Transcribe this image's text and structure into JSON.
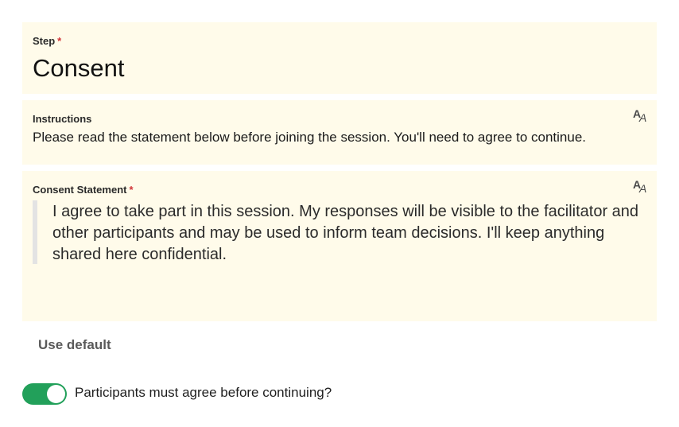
{
  "step": {
    "label": "Step",
    "required_mark": "*",
    "value": "Consent"
  },
  "instructions": {
    "label": "Instructions",
    "text": "Please read the statement below before joining the session. You'll need to agree to continue.",
    "format_icon": "text-format-icon"
  },
  "consent": {
    "label": "Consent Statement",
    "required_mark": "*",
    "text": "I agree to take part in this session. My responses will be visible to the facilitator and other participants and may be used to inform team decisions. I'll keep anything shared here confidential.",
    "format_icon": "text-format-icon"
  },
  "actions": {
    "use_default": "Use default"
  },
  "toggle": {
    "label": "Participants must agree before continuing?",
    "on": true
  },
  "colors": {
    "panel_background": "#fffbea",
    "required": "#d13438",
    "toggle_on": "#22a05a"
  }
}
